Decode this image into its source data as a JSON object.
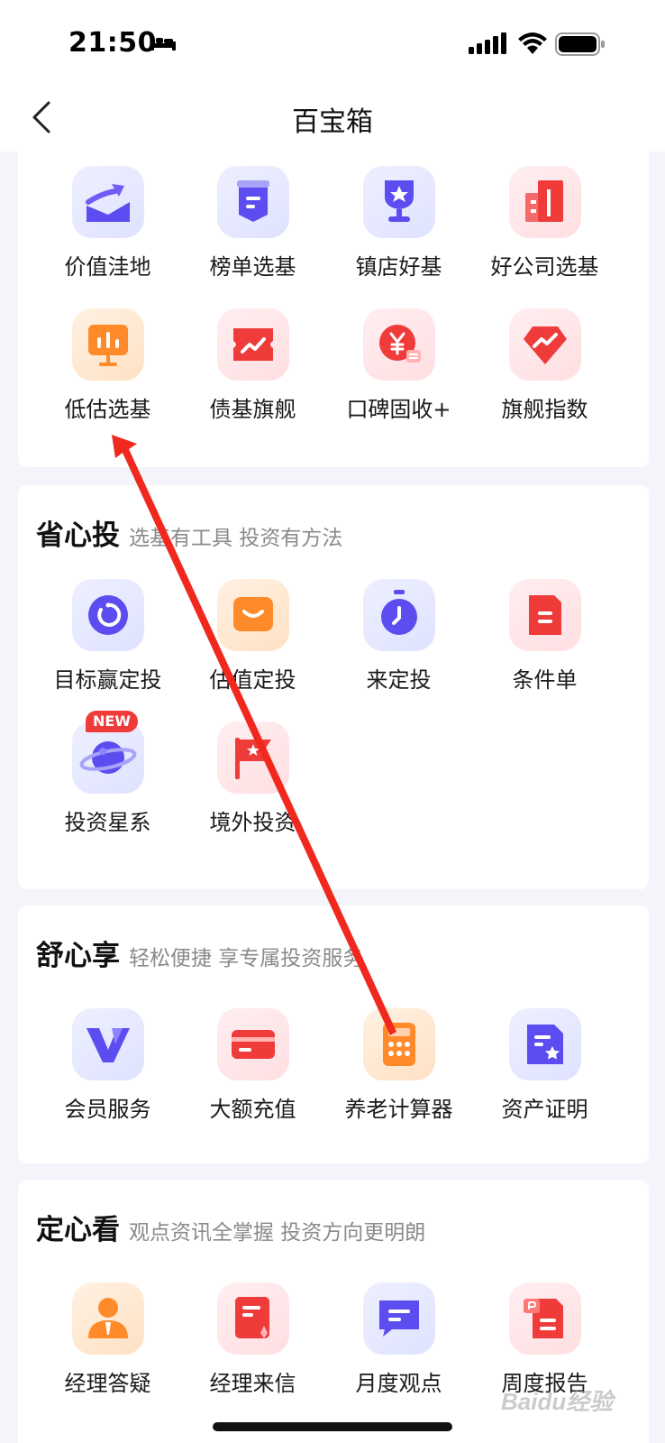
{
  "status_bar": {
    "time": "21:50"
  },
  "nav": {
    "title": "百宝箱"
  },
  "sections": [
    {
      "title": "",
      "subtitle": "",
      "items": [
        {
          "label": "价值洼地"
        },
        {
          "label": "榜单选基"
        },
        {
          "label": "镇店好基"
        },
        {
          "label": "好公司选基"
        },
        {
          "label": "低估选基"
        },
        {
          "label": "债基旗舰"
        },
        {
          "label": "口碑固收+"
        },
        {
          "label": "旗舰指数"
        }
      ]
    },
    {
      "title": "省心投",
      "subtitle": "选基有工具 投资有方法",
      "items": [
        {
          "label": "目标赢定投"
        },
        {
          "label": "估值定投"
        },
        {
          "label": "来定投"
        },
        {
          "label": "条件单"
        },
        {
          "label": "投资星系",
          "badge": "NEW"
        },
        {
          "label": "境外投资"
        }
      ]
    },
    {
      "title": "舒心享",
      "subtitle": "轻松便捷 享专属投资服务",
      "items": [
        {
          "label": "会员服务"
        },
        {
          "label": "大额充值"
        },
        {
          "label": "养老计算器"
        },
        {
          "label": "资产证明"
        }
      ]
    },
    {
      "title": "定心看",
      "subtitle": "观点资讯全掌握 投资方向更明朗",
      "items": [
        {
          "label": "经理答疑"
        },
        {
          "label": "经理来信"
        },
        {
          "label": "月度观点"
        },
        {
          "label": "周度报告"
        }
      ]
    }
  ],
  "watermark": "Baidu经验",
  "colors": {
    "accent_blue": "#5b4df0",
    "accent_red": "#f03b3b",
    "accent_orange": "#ff8a2a",
    "annotation_arrow": "#f0281e"
  }
}
